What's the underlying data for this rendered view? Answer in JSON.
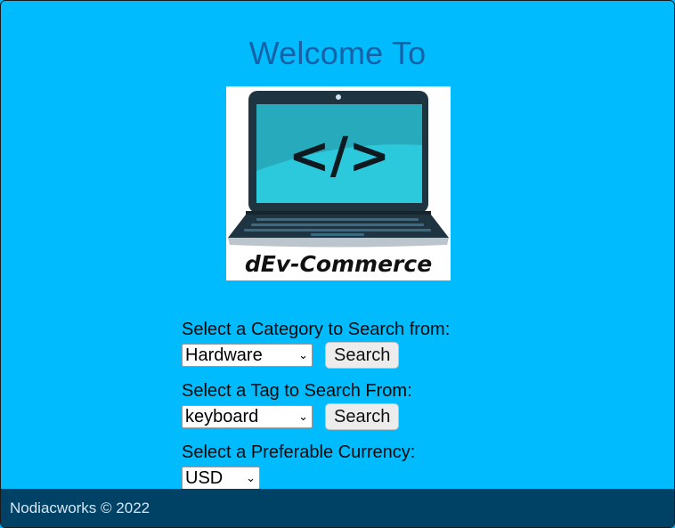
{
  "header": {
    "welcome_text": "Welcome To"
  },
  "logo": {
    "code_glyph": "</>",
    "wordmark": "dEv-Commerce"
  },
  "search_form": {
    "category_label": "Select a Category to Search from:",
    "category_value": "Hardware",
    "category_button": "Search",
    "tag_label": "Select a Tag to Search From:",
    "tag_value": "keyboard",
    "tag_button": "Search",
    "currency_label": "Select a Preferable Currency:",
    "currency_value": "USD"
  },
  "footer": {
    "text": "Nodiacworks © 2022"
  },
  "colors": {
    "page_background": "#00bcff",
    "heading": "#1762a6",
    "footer_background": "#004266"
  }
}
